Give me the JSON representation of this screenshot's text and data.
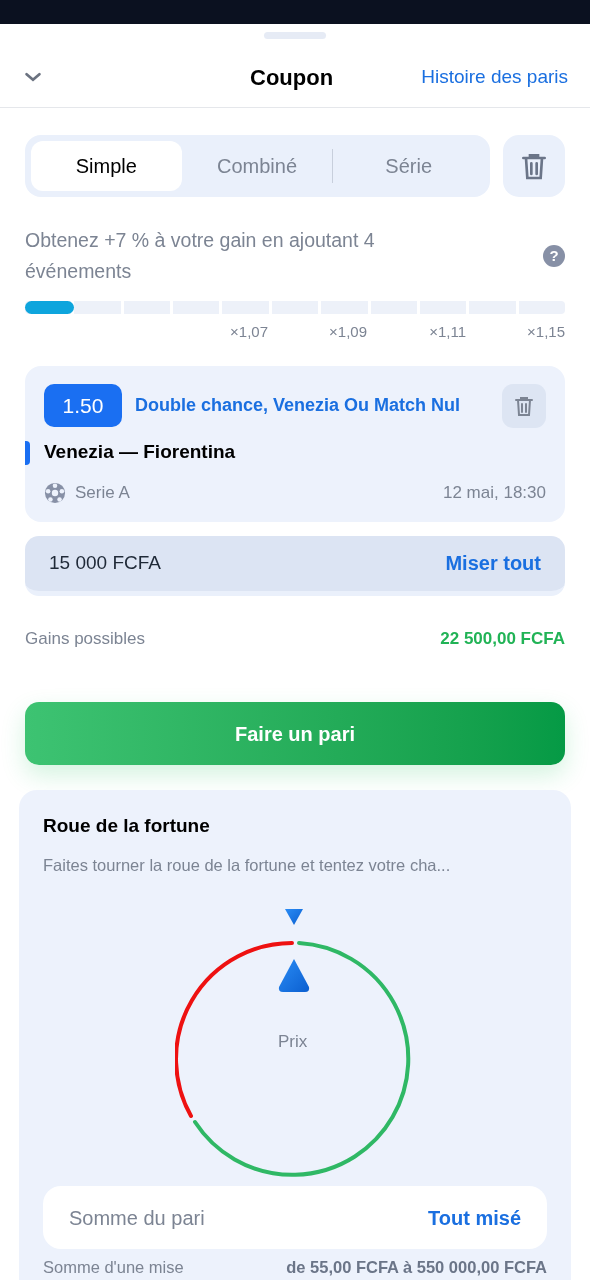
{
  "header": {
    "title": "Coupon",
    "link": "Histoire des paris"
  },
  "tabs": [
    {
      "label": "Simple",
      "selected": true
    },
    {
      "label": "Combiné",
      "selected": false
    },
    {
      "label": "Série",
      "selected": false
    }
  ],
  "promo": {
    "text": "Obtenez +7 % à votre gain en ajoutant 4 événements",
    "level": 0.09,
    "help": "?",
    "multipliers": [
      "×1,07",
      "×1,09",
      "×1,11",
      "×1,15"
    ]
  },
  "bet": {
    "odds": "1.50",
    "market": "Double chance, Venezia Ou Match Nul",
    "match": "Venezia — Fiorentina",
    "league": "Serie A",
    "time": "12 mai, 18:30"
  },
  "stake": {
    "value": "15 000 FCFA",
    "max_button": "Miser tout"
  },
  "winnings": {
    "label": "Gains possibles",
    "value": "22 500,00 FCFA"
  },
  "place_button": "Faire un pari",
  "wheel": {
    "title": "Roue de la fortune",
    "subtitle": "Faites tourner la roue de la fortune et tentez votre cha...",
    "center_label": "Prix",
    "amount_placeholder": "Somme du pari",
    "all_in_button": "Tout misé",
    "range_label": "Somme d'une mise",
    "range_value": "de 55,00 FCFA à 550 000,00 FCFA"
  }
}
